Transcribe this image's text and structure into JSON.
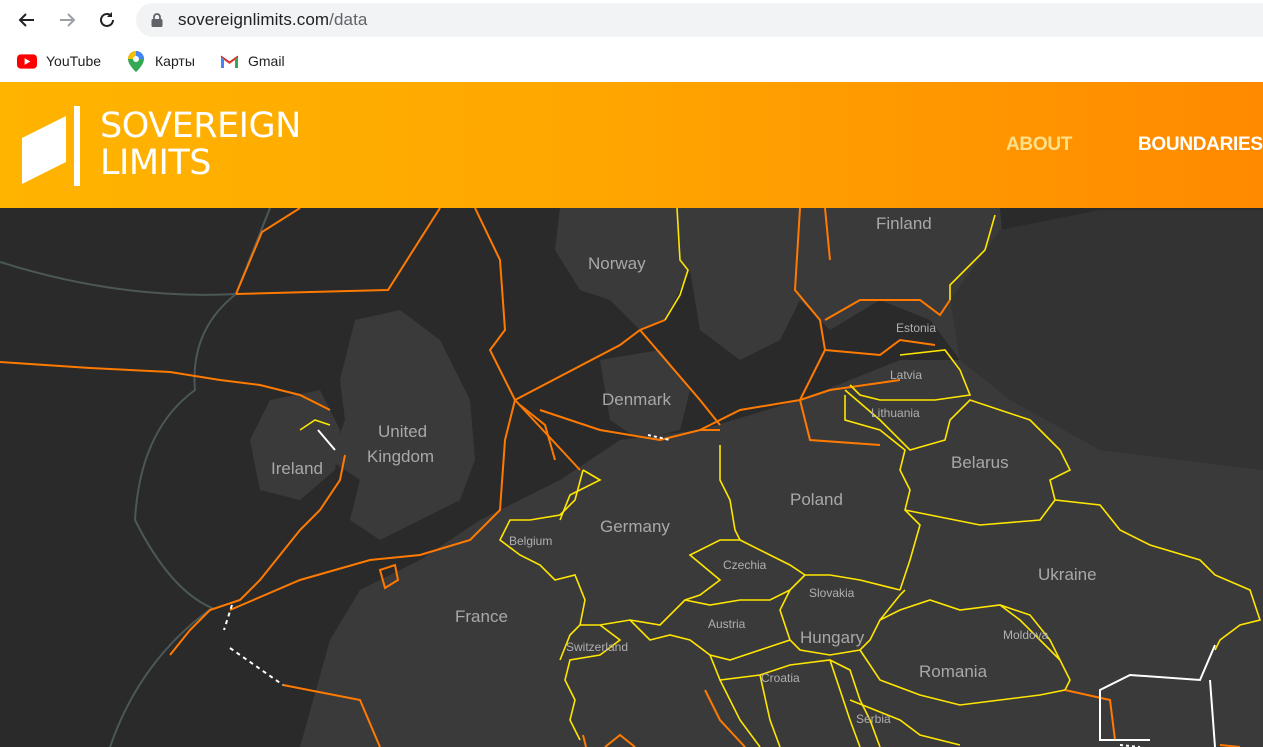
{
  "browser": {
    "url_domain": "sovereignlimits.com",
    "url_path": "/data",
    "bookmarks": [
      {
        "label": "YouTube",
        "icon": "youtube-icon"
      },
      {
        "label": "Карты",
        "icon": "maps-icon"
      },
      {
        "label": "Gmail",
        "icon": "gmail-icon"
      }
    ]
  },
  "site": {
    "logo_line1": "SOVEREIGN",
    "logo_line2": "LIMITS",
    "nav": {
      "about": "ABOUT",
      "boundaries": "BOUNDARIES"
    },
    "colors": {
      "header_start": "#ffb400",
      "header_end": "#ff8a00",
      "maritime_line": "#ff7a00",
      "land_line": "#ffee00",
      "undefined_line": "#ffffff"
    }
  },
  "map": {
    "labels": {
      "finland": "Finland",
      "norway": "Norway",
      "estonia": "Estonia",
      "latvia": "Latvia",
      "denmark": "Denmark",
      "lithuania": "Lithuania",
      "united_kingdom_1": "United",
      "united_kingdom_2": "Kingdom",
      "ireland": "Ireland",
      "belarus": "Belarus",
      "poland": "Poland",
      "germany": "Germany",
      "belgium": "Belgium",
      "czechia": "Czechia",
      "ukraine": "Ukraine",
      "slovakia": "Slovakia",
      "france": "France",
      "austria": "Austria",
      "hungary": "Hungary",
      "moldova": "Moldova",
      "switzerland": "Switzerland",
      "romania": "Romania",
      "croatia": "Croatia",
      "serbia": "Serbia"
    }
  }
}
